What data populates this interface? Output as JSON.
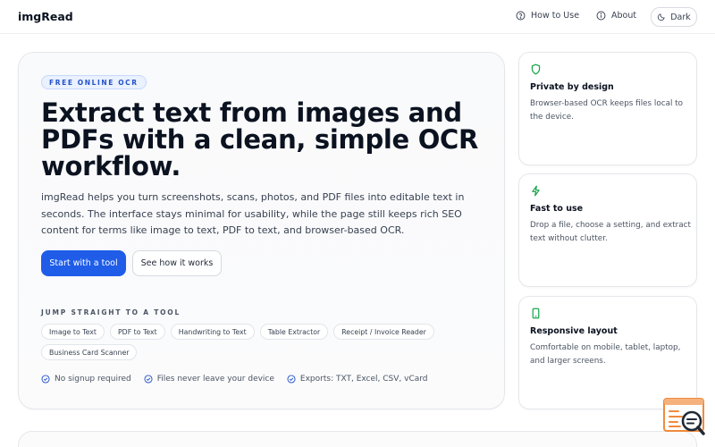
{
  "header": {
    "brand": "imgRead",
    "nav": [
      {
        "label": "How to Use",
        "icon": "question-circle-icon"
      },
      {
        "label": "About",
        "icon": "info-circle-icon"
      }
    ],
    "theme_toggle": {
      "label": "Dark",
      "icon": "moon-icon"
    }
  },
  "hero": {
    "badge": "FREE ONLINE OCR",
    "title": "Extract text from images and PDFs with a clean, simple OCR workflow.",
    "description": "imgRead helps you turn screenshots, scans, photos, and PDF files into editable text in seconds. The interface stays minimal for usability, while the page still keeps rich SEO content for terms like image to text, PDF to text, and browser-based OCR.",
    "primary_button": "Start with a tool",
    "secondary_button": "See how it works",
    "jump_label": "JUMP STRAIGHT TO A TOOL",
    "tools": [
      "Image to Text",
      "PDF to Text",
      "Handwriting to Text",
      "Table Extractor",
      "Receipt / Invoice Reader",
      "Business Card Scanner"
    ],
    "checks": [
      "No signup required",
      "Files never leave your device",
      "Exports: TXT, Excel, CSV, vCard"
    ]
  },
  "features": [
    {
      "icon": "shield-icon",
      "title": "Private by design",
      "description": "Browser-based OCR keeps files local to the device."
    },
    {
      "icon": "lightning-icon",
      "title": "Fast to use",
      "description": "Drop a file, choose a setting, and extract text without clutter."
    },
    {
      "icon": "mobile-icon",
      "title": "Responsive layout",
      "description": "Comfortable on mobile, tablet, laptop, and larger screens."
    }
  ],
  "colors": {
    "accent": "#1f5de8",
    "badge_text": "#2452c9",
    "feature_icon": "#16a34a"
  }
}
